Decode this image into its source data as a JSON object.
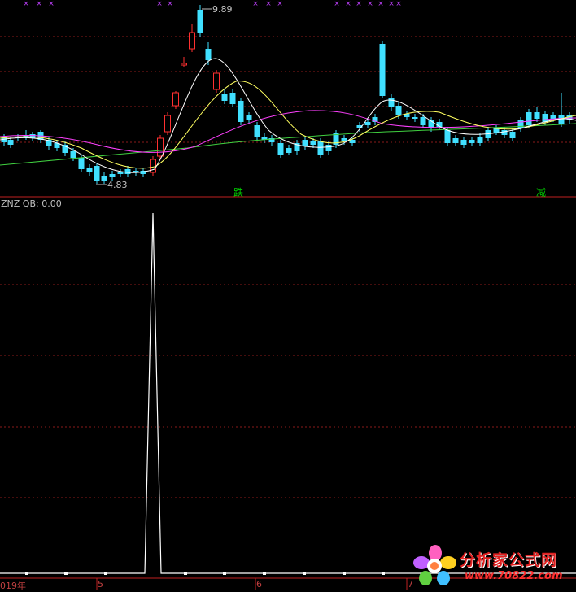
{
  "price_panel": {
    "high_label": "9.89",
    "low_label": "4.83",
    "signal_jump": "跌",
    "signal_reduce": "减",
    "colors": {
      "up": "#ff3030",
      "down": "#40e0ff",
      "ma1": "#ffffff",
      "ma2": "#ffff60",
      "ma3": "#ff40ff",
      "ma4": "#40d040",
      "marks": "#c040ff"
    }
  },
  "indicator_panel": {
    "title": "ZNZ QB: 0.00",
    "line_color": "#ffffff",
    "spike": 1
  },
  "axis": {
    "year_label": "019年",
    "month_5": "5",
    "month_6": "6",
    "month_7": "7"
  },
  "watermark": {
    "text": "分析家公式网",
    "url": "www.70822.com"
  }
}
